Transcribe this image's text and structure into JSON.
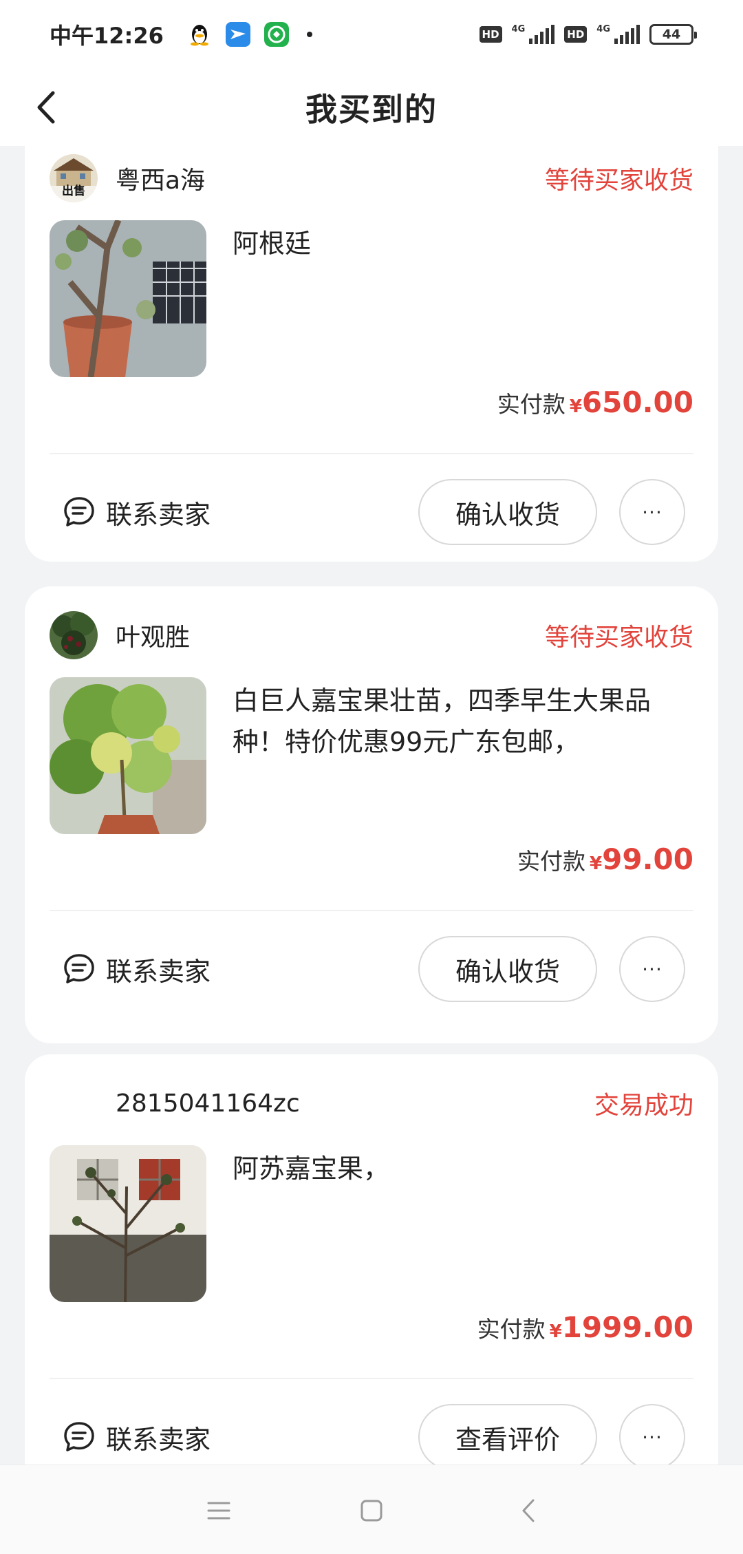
{
  "status_bar": {
    "time": "中午12:26",
    "network_1": "4G",
    "network_2": "4G",
    "hd_1": "HD",
    "hd_2": "HD",
    "battery": "44"
  },
  "header": {
    "title": "我买到的"
  },
  "orders": [
    {
      "seller": "粤西a海",
      "avatar_badge": "出售",
      "status": "等待买家收货",
      "description": "阿根廷",
      "paid_label": "实付款",
      "currency": "¥",
      "amount": "650.00",
      "contact_label": "联系卖家",
      "action_label": "确认收货",
      "more_label": "···"
    },
    {
      "seller": "叶观胜",
      "status": "等待买家收货",
      "description": "白巨人嘉宝果壮苗，四季早生大果品种！特价优惠99元广东包邮，",
      "paid_label": "实付款",
      "currency": "¥",
      "amount": "99.00",
      "contact_label": "联系卖家",
      "action_label": "确认收货",
      "more_label": "···"
    },
    {
      "seller": "2815041164zc",
      "status": "交易成功",
      "description": "阿苏嘉宝果，",
      "paid_label": "实付款",
      "currency": "¥",
      "amount": "1999.00",
      "contact_label": "联系卖家",
      "action_label": "查看评价",
      "more_label": "···"
    }
  ],
  "colors": {
    "accent": "#e2433b",
    "background": "#f2f3f5",
    "card": "#ffffff"
  },
  "nav": {
    "menu_icon": "menu-icon",
    "home_icon": "home-square-icon",
    "back_icon": "back-triangle-icon"
  }
}
